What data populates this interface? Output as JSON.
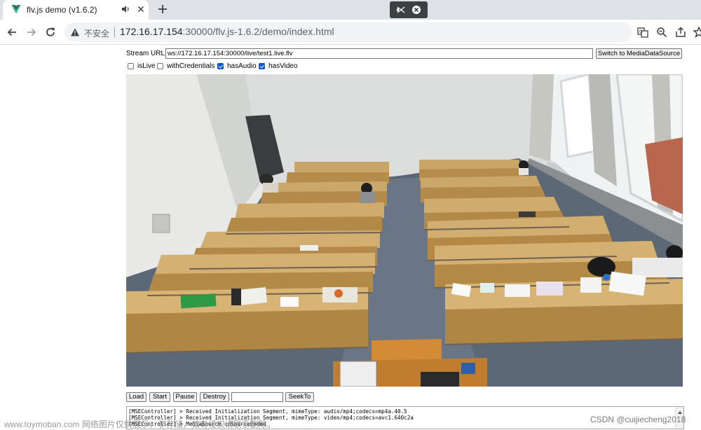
{
  "browser": {
    "tab_title": "flv.js demo (v1.6.2)",
    "security_label": "不安全",
    "url_host": "172.16.17.154",
    "url_rest": ":30000/flv.js-1.6.2/demo/index.html"
  },
  "form": {
    "stream_label": "Stream URL:",
    "stream_url": "ws://172.16.17.154:30000/live/test1.live.flv",
    "switch_button": "Switch to MediaDataSource",
    "options": [
      {
        "label": "isLive",
        "checked": false
      },
      {
        "label": "withCredentials",
        "checked": false
      },
      {
        "label": "hasAudio",
        "checked": true
      },
      {
        "label": "hasVideo",
        "checked": true
      }
    ]
  },
  "controls": {
    "load": "Load",
    "start": "Start",
    "pause": "Pause",
    "destroy": "Destroy",
    "seek_value": "",
    "seekto": "SeekTo"
  },
  "log": {
    "lines": [
      "[MSEController] > Received Initialization Segment, mimeType: audio/mp4;codecs=mp4a.40.5",
      "[MSEController] > Received Initialization Segment, mimeType: video/mp4;codecs=avc1.640c2a",
      "[MSEController] > MediaSource onSourceEnded"
    ]
  },
  "watermarks": {
    "left": "www.toymoban.com 网络图片仅供展示，非存储，如有侵权请联系删除。",
    "right": "CSDN @cuijiecheng2018"
  },
  "icons": {
    "tab_logo": "vue-logo-icon",
    "audio": "speaker-icon",
    "close": "close-icon",
    "new_tab": "plus-icon",
    "cast": "cast-icon",
    "cast_stop": "stop-icon",
    "back": "back-arrow-icon",
    "forward": "forward-arrow-icon",
    "reload": "reload-icon",
    "warning": "warning-icon",
    "translate": "translate-icon",
    "zoom": "zoom-icon",
    "share": "share-icon",
    "bookmark": "star-icon"
  },
  "colors": {
    "accent": "#0b57d0",
    "tabbar": "#dee1e6",
    "vue_green": "#41b883",
    "vue_dark": "#35495e"
  }
}
